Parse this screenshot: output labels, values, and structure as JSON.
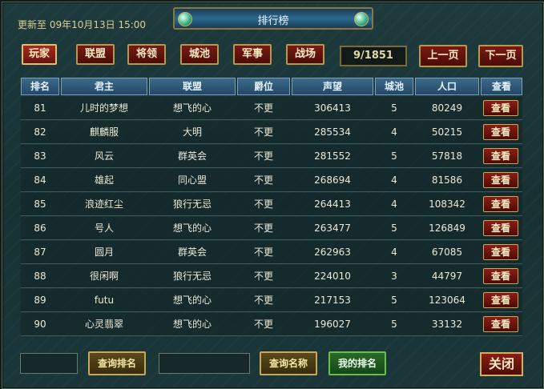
{
  "header": {
    "updated_text": "更新至 09年10月13日 15:00",
    "title": "排行榜"
  },
  "tabs": [
    {
      "label": "玩家",
      "active": true
    },
    {
      "label": "联盟",
      "active": false
    },
    {
      "label": "将领",
      "active": false
    },
    {
      "label": "城池",
      "active": false
    },
    {
      "label": "军事",
      "active": false
    },
    {
      "label": "战场",
      "active": false
    }
  ],
  "pagination": {
    "page_indicator": "9/1851",
    "prev_label": "上一页",
    "next_label": "下一页"
  },
  "table": {
    "columns": [
      "排名",
      "君主",
      "联盟",
      "爵位",
      "声望",
      "城池",
      "人口",
      "查看"
    ],
    "view_button_label": "查看",
    "rows": [
      {
        "rank": "81",
        "lord": "儿时的梦想",
        "alliance": "想飞的心",
        "title": "不更",
        "prestige": "306413",
        "cities": "5",
        "population": "80249"
      },
      {
        "rank": "82",
        "lord": "麒麟服",
        "alliance": "大明",
        "title": "不更",
        "prestige": "285534",
        "cities": "4",
        "population": "50215"
      },
      {
        "rank": "83",
        "lord": "风云",
        "alliance": "群英会",
        "title": "不更",
        "prestige": "281552",
        "cities": "5",
        "population": "57818"
      },
      {
        "rank": "84",
        "lord": "雄起",
        "alliance": "同心盟",
        "title": "不更",
        "prestige": "268694",
        "cities": "4",
        "population": "81586"
      },
      {
        "rank": "85",
        "lord": "浪迹红尘",
        "alliance": "狼行无忌",
        "title": "不更",
        "prestige": "264413",
        "cities": "4",
        "population": "108342"
      },
      {
        "rank": "86",
        "lord": "号人",
        "alliance": "想飞的心",
        "title": "不更",
        "prestige": "263477",
        "cities": "5",
        "population": "126849"
      },
      {
        "rank": "87",
        "lord": "圆月",
        "alliance": "群英会",
        "title": "不更",
        "prestige": "262963",
        "cities": "4",
        "population": "67085"
      },
      {
        "rank": "88",
        "lord": "很闲啊",
        "alliance": "狼行无忌",
        "title": "不更",
        "prestige": "224010",
        "cities": "3",
        "population": "44797"
      },
      {
        "rank": "89",
        "lord": "futu",
        "alliance": "想飞的心",
        "title": "不更",
        "prestige": "217153",
        "cities": "5",
        "population": "123064"
      },
      {
        "rank": "90",
        "lord": "心灵翡翠",
        "alliance": "想飞的心",
        "title": "不更",
        "prestige": "196027",
        "cities": "5",
        "population": "33132"
      }
    ]
  },
  "footer": {
    "search_rank_label": "查询排名",
    "search_name_label": "查询名称",
    "my_rank_label": "我的排名",
    "close_label": "关闭"
  }
}
